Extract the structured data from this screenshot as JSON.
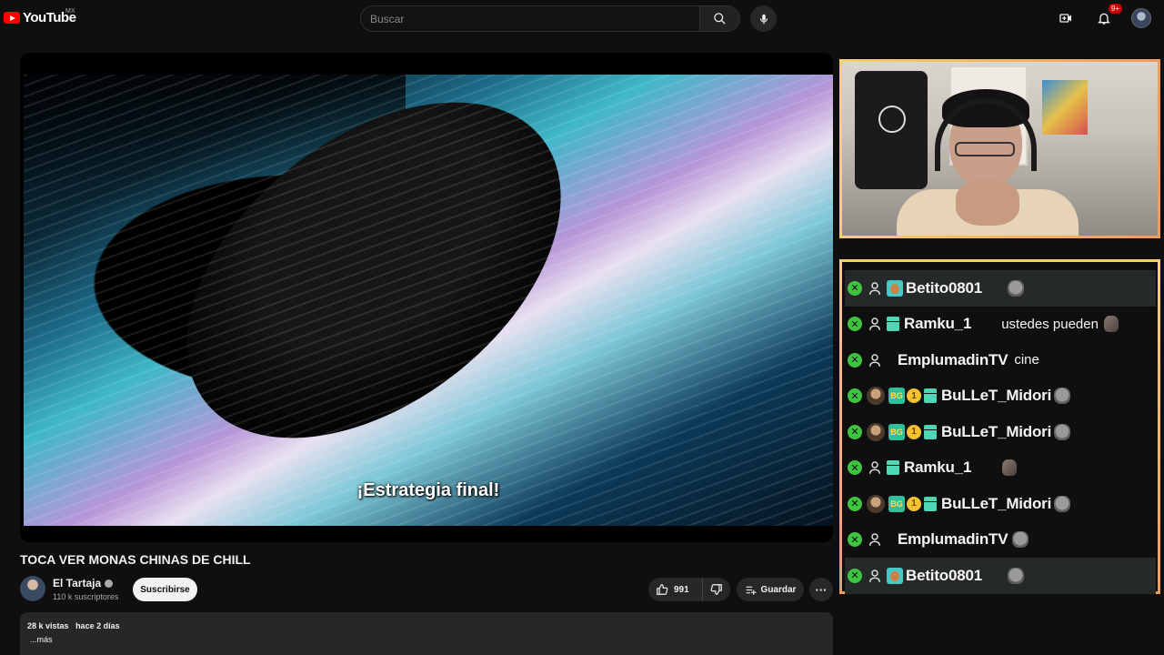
{
  "header": {
    "logo_text": "YouTube",
    "country": "MX",
    "search_placeholder": "Buscar",
    "notifications_badge": "9+"
  },
  "video": {
    "subtitle": "¡Estrategia final!",
    "title": "TOCA VER MONAS CHINAS DE CHILL",
    "channel_name": "El Tartaja",
    "subscribers": "110 k suscriptores",
    "subscribe_label": "Suscribirse",
    "likes": "991",
    "save_label": "Guardar",
    "more_label": "···",
    "description": {
      "views": "28 k vistas",
      "date": "hace 2 días",
      "more": "...más"
    }
  },
  "chat": {
    "messages": [
      {
        "user": "Betito0801",
        "text": "",
        "highlighted": true
      },
      {
        "user": "Ramku_1",
        "text": "ustedes pueden",
        "highlighted": false
      },
      {
        "user": "EmplumadinTV",
        "text": "cine",
        "highlighted": false
      },
      {
        "user": "BuLLeT_Midori",
        "text": "",
        "tier_badge": "1",
        "highlighted": false
      },
      {
        "user": "BuLLeT_Midori",
        "text": "",
        "tier_badge": "1",
        "highlighted": false
      },
      {
        "user": "Ramku_1",
        "text": "",
        "highlighted": false
      },
      {
        "user": "BuLLeT_Midori",
        "text": "",
        "tier_badge": "1",
        "highlighted": false
      },
      {
        "user": "EmplumadinTV",
        "text": "",
        "highlighted": false
      },
      {
        "user": "Betito0801",
        "text": "",
        "highlighted": true
      }
    ],
    "mod_badge_glyph": "✕"
  },
  "colors": {
    "overlay_border_start": "#f3d26a",
    "overlay_border_end": "#f29b57",
    "mod_badge": "#3ec43e",
    "youtube_red": "#ff0000"
  }
}
